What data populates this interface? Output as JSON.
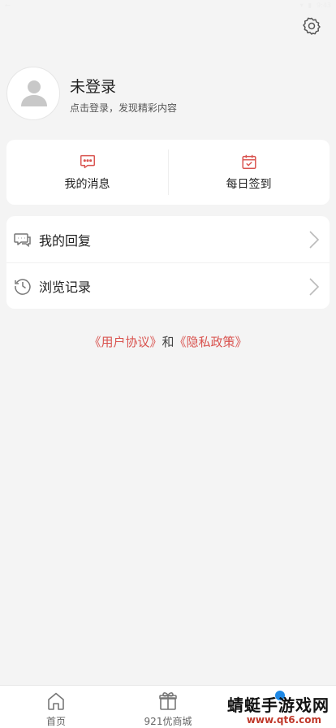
{
  "status_bar": {
    "left": "←",
    "right": "9:43"
  },
  "profile": {
    "name": "未登录",
    "subtitle": "点击登录，发现精彩内容"
  },
  "quick_actions": [
    {
      "label": "我的消息",
      "icon": "message-icon"
    },
    {
      "label": "每日签到",
      "icon": "calendar-check-icon"
    }
  ],
  "menu": [
    {
      "label": "我的回复",
      "icon": "reply-icon"
    },
    {
      "label": "浏览记录",
      "icon": "history-icon"
    }
  ],
  "policy": {
    "user_agreement": "《用户协议》",
    "and": "和",
    "privacy_policy": "《隐私政策》"
  },
  "tabbar": [
    {
      "label": "首页",
      "icon": "home-icon"
    },
    {
      "label": "921优商城",
      "icon": "shop-icon"
    },
    {
      "label": "",
      "icon": "profile-icon",
      "badge": true
    }
  ],
  "watermark": {
    "line1": "蜻蜓手游戏网",
    "line2": "www.qt6.com"
  },
  "colors": {
    "accent": "#d9534f",
    "background": "#f4f4f4",
    "badge": "#1e88e5"
  }
}
